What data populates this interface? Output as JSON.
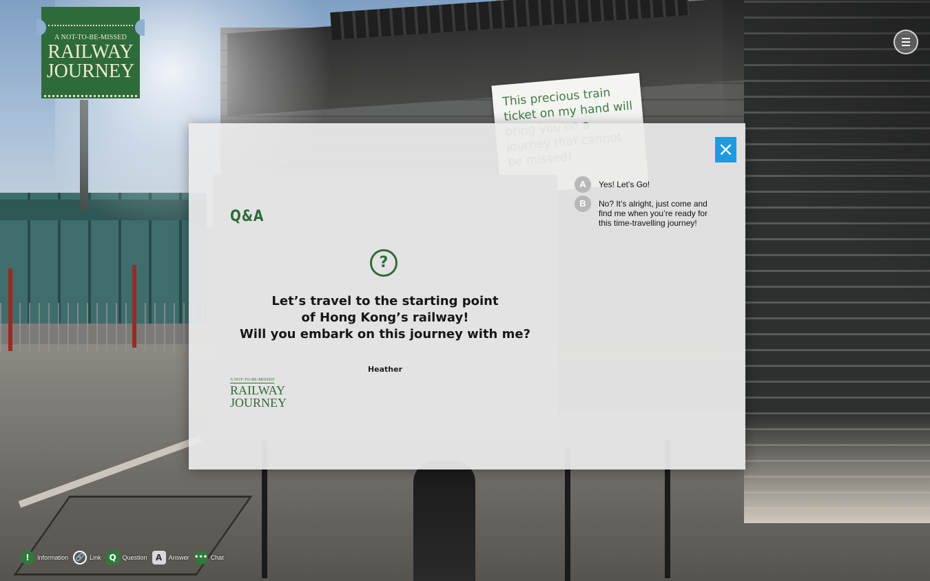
{
  "logo": {
    "subtitle": "A NOT-TO-BE-MISSED",
    "title_line1": "RAILWAY",
    "title_line2": "JOURNEY"
  },
  "menu": {
    "icon": "hamburger-menu-icon"
  },
  "scene": {
    "notice_text": "This precious train ticket on my hand will bring you on a journey that cannot be missed!"
  },
  "modal": {
    "close_label": "×",
    "qa_title": "Q&A",
    "question_icon": "?",
    "question_lines": [
      "Let’s travel to the starting point",
      "of Hong Kong’s railway!",
      "Will you embark on this journey with me?"
    ],
    "author": "Heather",
    "card_logo": {
      "subtitle": "A NOT-TO-BE-MISSED",
      "title_line1": "RAILWAY",
      "title_line2": "JOURNEY"
    },
    "answers": [
      {
        "badge": "A",
        "text": "Yes! Let’s Go!"
      },
      {
        "badge": "B",
        "text": "No? It’s alright, just come and find me when you’re ready for this time-travelling journey!"
      }
    ]
  },
  "legend": [
    {
      "icon": "!",
      "label": "Information"
    },
    {
      "icon": "🔗",
      "label": "Link"
    },
    {
      "icon": "Q",
      "label": "Question"
    },
    {
      "icon": "A",
      "label": "Answer"
    },
    {
      "icon": "•••",
      "label": "Chat"
    }
  ],
  "colors": {
    "brand_green": "#2f6b38",
    "close_blue": "#1e9be0",
    "answer_badge": "#b8b8b8"
  }
}
